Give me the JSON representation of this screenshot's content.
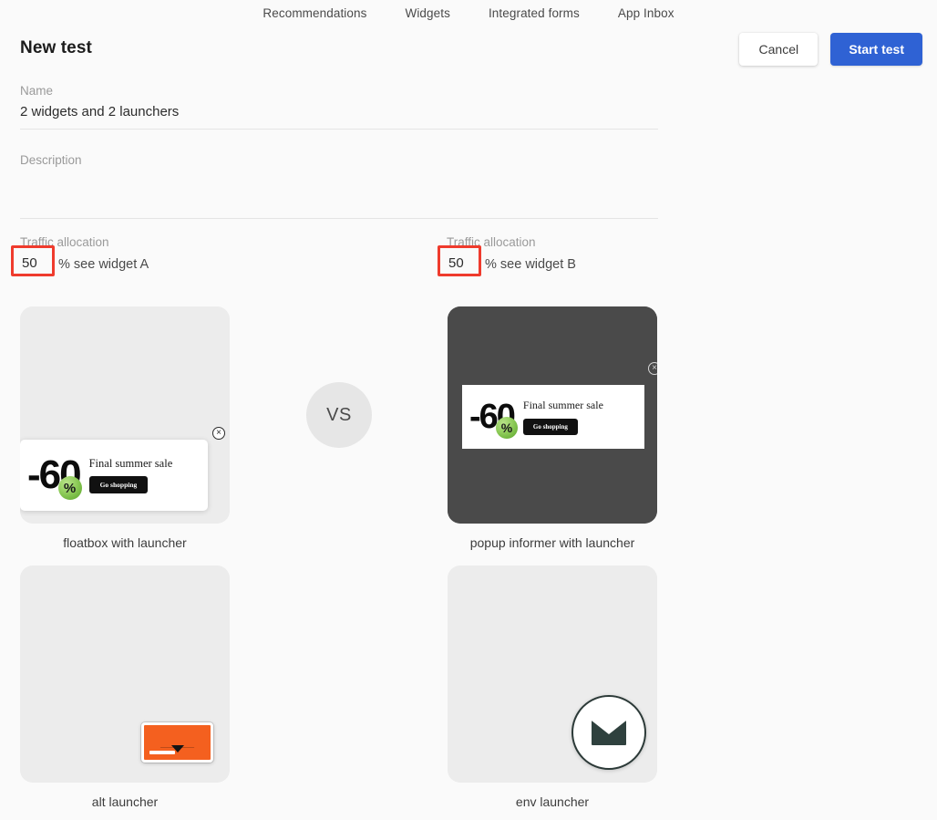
{
  "topnav": {
    "items": [
      {
        "label": "Recommendations"
      },
      {
        "label": "Widgets"
      },
      {
        "label": "Integrated forms"
      },
      {
        "label": "App Inbox"
      }
    ]
  },
  "header": {
    "title": "New test",
    "cancel_label": "Cancel",
    "start_label": "Start test",
    "primary_color": "#2f62d4"
  },
  "form": {
    "name": {
      "label": "Name",
      "value": "2 widgets and 2 launchers",
      "placeholder": "Name"
    },
    "description": {
      "label": "Description",
      "value": "",
      "placeholder": "Description"
    }
  },
  "allocation": {
    "highlight_color": "#ef3b2d",
    "a": {
      "label": "Traffic allocation",
      "value": "50",
      "suffix": "% see widget A"
    },
    "b": {
      "label": "Traffic allocation",
      "value": "50",
      "suffix": "% see widget B"
    }
  },
  "vs": {
    "label": "VS"
  },
  "previews": {
    "a_top": {
      "caption": "floatbox with launcher",
      "promo": {
        "discount": "-60",
        "percent": "%",
        "title": "Final summer sale",
        "button": "Go shopping"
      },
      "close": "×"
    },
    "b_top": {
      "caption": "popup informer with launcher",
      "promo": {
        "discount": "-60",
        "percent": "%",
        "title": "Final summer sale",
        "button": "Go shopping"
      },
      "close": "×"
    },
    "a_bottom": {
      "caption": "alt launcher",
      "launcher_color": "#f4601f"
    },
    "b_bottom": {
      "caption": "env launcher",
      "launcher_color": "#2f413e"
    }
  }
}
